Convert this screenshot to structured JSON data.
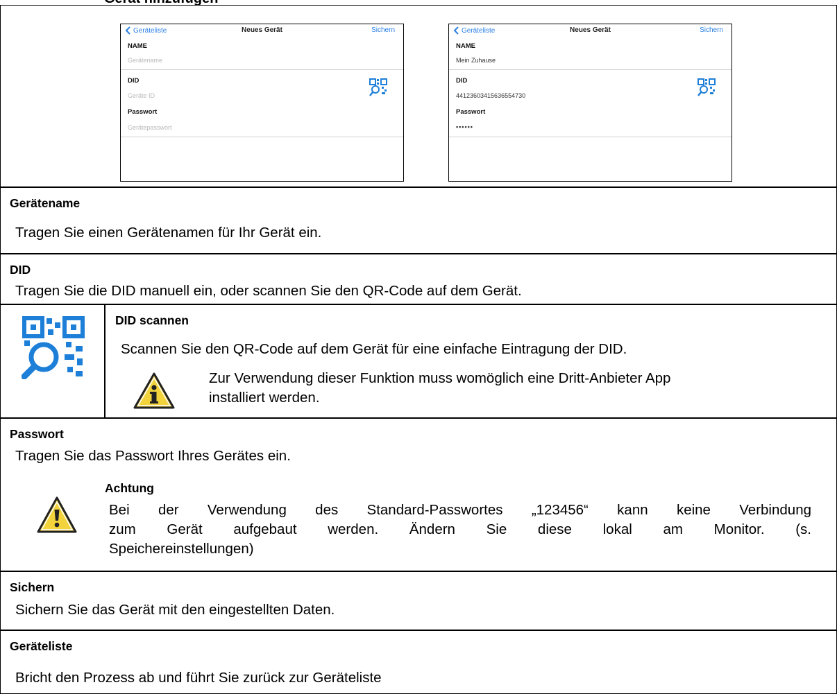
{
  "heading": "Gerät hinzufügen",
  "screenshots": {
    "left": {
      "back_label": "Geräteliste",
      "title": "Neues Gerät",
      "save_label": "Sichern",
      "name_label": "NAME",
      "name_value": "Gerätename",
      "did_label": "DID",
      "did_value": "Geräte ID",
      "password_label": "Passwort",
      "password_value": "Gerätepasswort"
    },
    "right": {
      "back_label": "Geräteliste",
      "title": "Neues Gerät",
      "save_label": "Sichern",
      "name_label": "NAME",
      "name_value": "Mein Zuhause",
      "did_label": "DID",
      "did_value": "44123603415636554730",
      "password_label": "Passwort",
      "password_value": "••••••"
    }
  },
  "sections": {
    "geraetename": {
      "title": "Gerätename",
      "text": "Tragen Sie einen Gerätenamen für Ihr Gerät ein."
    },
    "did": {
      "title": "DID",
      "text": "Tragen Sie die DID manuell ein, oder scannen Sie den QR-Code auf dem Gerät."
    },
    "did_scan": {
      "title": "DID scannen",
      "text": "Scannen Sie den QR-Code auf dem Gerät für eine einfache Eintragung der DID.",
      "note_line1": "Zur Verwendung dieser Funktion muss womöglich eine Dritt-Anbieter App",
      "note_line2": "installiert werden."
    },
    "passwort": {
      "title": "Passwort",
      "text": "Tragen Sie das Passwort Ihres Gerätes ein.",
      "warning_title": "Achtung",
      "warning_line1": "Bei der Verwendung des Standard-Passwortes „123456“ kann keine Verbindung",
      "warning_line2": "zum Gerät aufgebaut werden. Ändern Sie diese lokal am Monitor. (s.",
      "warning_line3": "Speichereinstellungen)"
    },
    "sichern": {
      "title": "Sichern",
      "text": "Sichern Sie das Gerät mit den eingestellten Daten."
    },
    "geraeteliste": {
      "title": "Geräteliste",
      "text": "Bricht den Prozess ab und führt Sie zurück zur Geräteliste"
    }
  },
  "colors": {
    "ios_blue": "#2a7fe4",
    "qr_blue": "#1e7fd8",
    "warning_yellow": "#f3d33b"
  }
}
